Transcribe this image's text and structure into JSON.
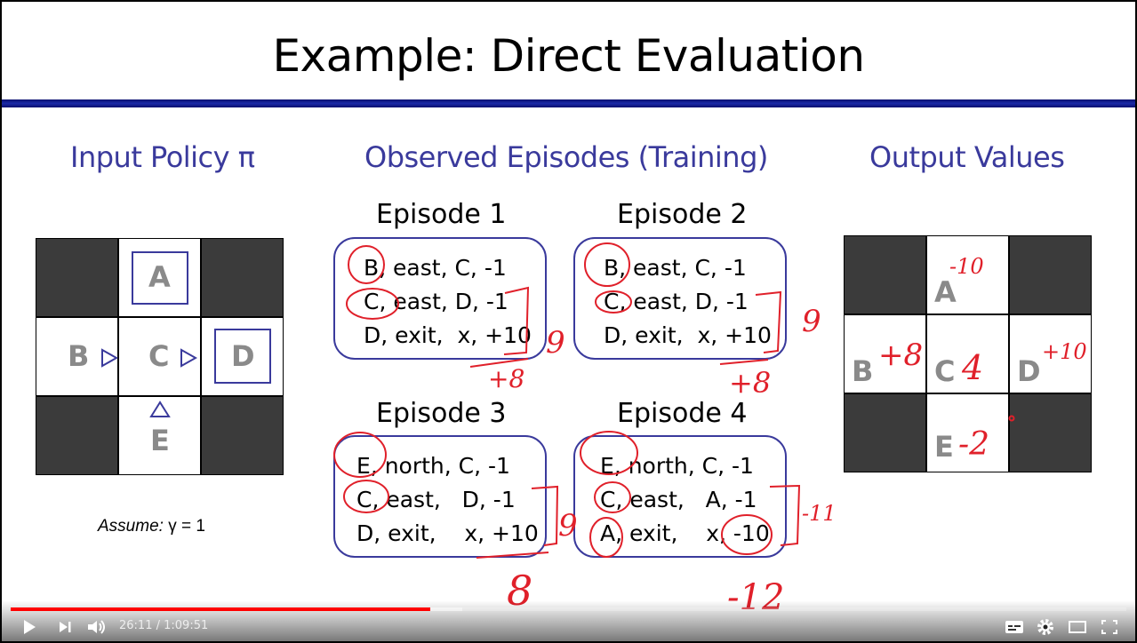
{
  "slide": {
    "title": "Example: Direct Evaluation",
    "headers": {
      "input": "Input Policy π",
      "episodes": "Observed Episodes (Training)",
      "output": "Output Values"
    },
    "input_grid": {
      "labels": {
        "A": "A",
        "B": "B",
        "C": "C",
        "D": "D",
        "E": "E"
      }
    },
    "assume": {
      "prefix": "Assume:",
      "expr": "γ = 1"
    },
    "episodes": [
      {
        "title": "Episode 1",
        "lines": [
          "B, east, C, -1",
          "C, east, D, -1",
          "D, exit,  x, +10"
        ]
      },
      {
        "title": "Episode 2",
        "lines": [
          "B, east, C, -1",
          "C, east, D, -1",
          "D, exit,  x, +10"
        ]
      },
      {
        "title": "Episode 3",
        "lines": [
          "E, north, C, -1",
          "C, east,   D, -1",
          "D, exit,    x, +10"
        ]
      },
      {
        "title": "Episode 4",
        "lines": [
          "E, north, C, -1",
          "C, east,   A, -1",
          "A, exit,    x, -10"
        ]
      }
    ],
    "output_grid": {
      "labels": {
        "A": "A",
        "B": "B",
        "C": "C",
        "D": "D",
        "E": "E"
      }
    },
    "annotations": {
      "ep1_sum": "9",
      "ep1_val": "+8",
      "ep2_sum": "9",
      "ep2_val": "+8",
      "ep3_sum": "9",
      "ep3_val": "8",
      "ep4_sum": "-11",
      "ep4_val": "-12",
      "out_A": "-10",
      "out_B": "+8",
      "out_C": "4",
      "out_D": "+10",
      "out_E": "-2"
    },
    "colors": {
      "heading": "#3a3a9c",
      "ink": "#e0202a",
      "dark_cell": "#3b3b3b"
    }
  },
  "player": {
    "time_current": "26:11",
    "time_separator": " / ",
    "time_total": "1:09:51",
    "progress_fraction": 0.376,
    "buffer_fraction": 0.405,
    "icons": [
      "play-icon",
      "next-icon",
      "volume-icon",
      "subtitles-icon",
      "settings-icon",
      "theater-mode-icon",
      "fullscreen-icon"
    ]
  }
}
